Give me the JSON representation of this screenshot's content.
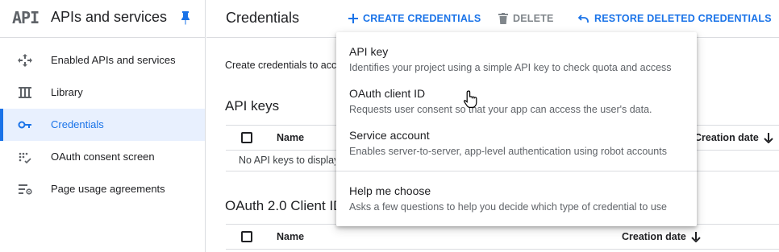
{
  "sidebar": {
    "logo_text": "API",
    "title": "APIs and services",
    "pin_icon": "pin-icon",
    "items": [
      {
        "label": "Enabled APIs and services",
        "icon": "enabled-apis-icon"
      },
      {
        "label": "Library",
        "icon": "library-icon"
      },
      {
        "label": "Credentials",
        "icon": "key-icon",
        "active": true
      },
      {
        "label": "OAuth consent screen",
        "icon": "consent-icon"
      },
      {
        "label": "Page usage agreements",
        "icon": "settings-list-icon"
      }
    ]
  },
  "header": {
    "title": "Credentials",
    "create_label": "CREATE CREDENTIALS",
    "delete_label": "DELETE",
    "restore_label": "RESTORE DELETED CREDENTIALS"
  },
  "main": {
    "intro": "Create credentials to access your enabled APIs",
    "api_keys": {
      "title": "API keys",
      "col_name": "Name",
      "col_date": "Creation date",
      "empty": "No API keys to display"
    },
    "oauth": {
      "title": "OAuth 2.0 Client IDs",
      "col_name": "Name",
      "col_date": "Creation date"
    }
  },
  "menu": {
    "items": [
      {
        "title": "API key",
        "desc": "Identifies your project using a simple API key to check quota and access"
      },
      {
        "title": "OAuth client ID",
        "desc": "Requests user consent so that your app can access the user's data."
      },
      {
        "title": "Service account",
        "desc": "Enables server-to-server, app-level authentication using robot accounts"
      },
      {
        "title": "Help me choose",
        "desc": "Asks a few questions to help you decide which type of credential to use"
      }
    ]
  },
  "colors": {
    "accent": "#1a73e8",
    "active_bg": "#e8f0fe",
    "disabled": "#80868b",
    "divider": "#dadce0"
  }
}
